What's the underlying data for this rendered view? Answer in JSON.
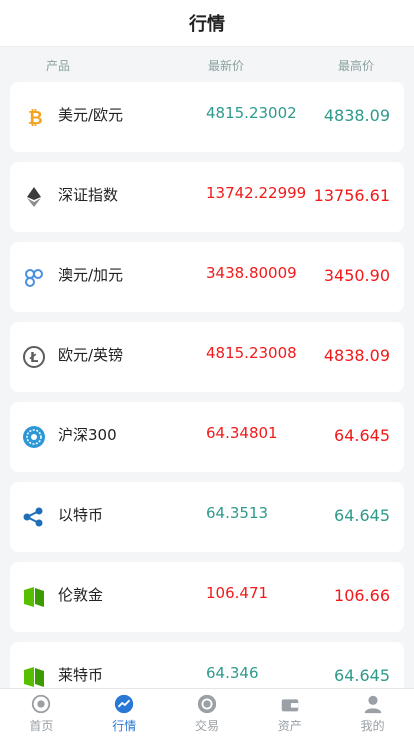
{
  "header": {
    "title": "行情"
  },
  "columns": {
    "product": "产品",
    "latest": "最新价",
    "high": "最高价"
  },
  "rows": [
    {
      "name": "美元/欧元",
      "latest": "4815.23002",
      "high": "4838.09",
      "icon": "bitcoin-icon"
    },
    {
      "name": "深证指数",
      "latest": "13742.22999",
      "high": "13756.61",
      "icon": "ethereum-icon"
    },
    {
      "name": "澳元/加元",
      "latest": "3438.80009",
      "high": "3450.90",
      "icon": "dots-icon"
    },
    {
      "name": "欧元/英镑",
      "latest": "4815.23008",
      "high": "4838.09",
      "icon": "litecoin-icon"
    },
    {
      "name": "沪深300",
      "latest": "64.34801",
      "high": "64.645",
      "icon": "globe-icon"
    },
    {
      "name": "以特币",
      "latest": "64.3513",
      "high": "64.645",
      "icon": "ripple-icon"
    },
    {
      "name": "伦敦金",
      "latest": "106.471",
      "high": "106.66",
      "icon": "neo-icon"
    },
    {
      "name": "莱特币",
      "latest": "64.346",
      "high": "64.645",
      "icon": "neo-icon"
    }
  ],
  "tabs": [
    {
      "label": "首页",
      "icon": "home-icon"
    },
    {
      "label": "行情",
      "icon": "chart-icon"
    },
    {
      "label": "交易",
      "icon": "exchange-icon"
    },
    {
      "label": "资产",
      "icon": "wallet-icon"
    },
    {
      "label": "我的",
      "icon": "user-icon"
    }
  ],
  "colors": {
    "up": "#2e9a8c",
    "down": "#f11a1a",
    "active_tab": "#2a78d6"
  }
}
